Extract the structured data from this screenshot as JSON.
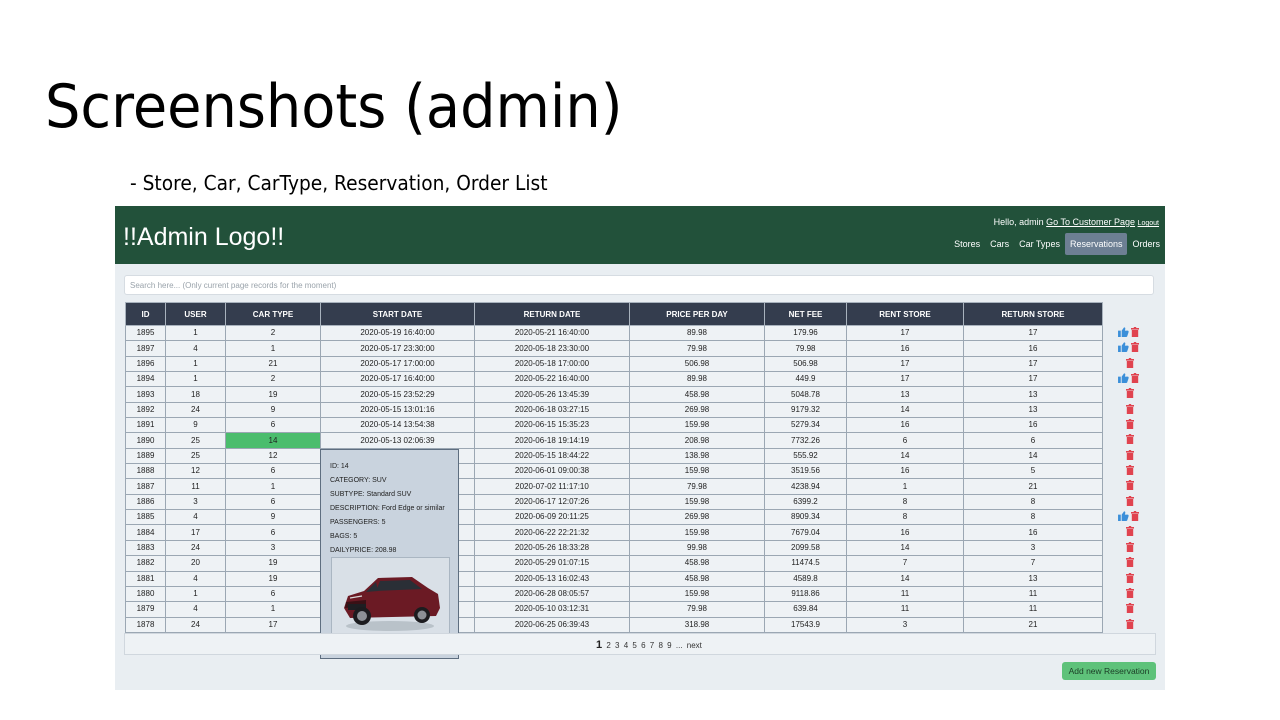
{
  "slide": {
    "title": "Screenshots (admin)",
    "subtitle": "- Store, Car, CarType, Reservation, Order List"
  },
  "app": {
    "logo": "!!Admin Logo!!",
    "greeting": "Hello, admin",
    "customer_link": "Go To Customer Page",
    "logout": "Logout",
    "nav": [
      "Stores",
      "Cars",
      "Car Types",
      "Reservations",
      "Orders"
    ],
    "active_nav": "Reservations",
    "colors": {
      "header": "#22513a",
      "table_header": "#343d4e",
      "highlight": "#4bbd6d",
      "add_button": "#5ec27a"
    }
  },
  "search": {
    "placeholder": "Search here... (Only current page records for the moment)",
    "value": ""
  },
  "table": {
    "columns": [
      "ID",
      "USER",
      "CAR TYPE",
      "START DATE",
      "RETURN DATE",
      "PRICE PER DAY",
      "NET FEE",
      "RENT STORE",
      "RETURN STORE"
    ],
    "rows": [
      [
        "1895",
        "1",
        "2",
        "2020-05-19 16:40:00",
        "2020-05-21 16:40:00",
        "89.98",
        "179.96",
        "17",
        "17"
      ],
      [
        "1897",
        "4",
        "1",
        "2020-05-17 23:30:00",
        "2020-05-18 23:30:00",
        "79.98",
        "79.98",
        "16",
        "16"
      ],
      [
        "1896",
        "1",
        "21",
        "2020-05-17 17:00:00",
        "2020-05-18 17:00:00",
        "506.98",
        "506.98",
        "17",
        "17"
      ],
      [
        "1894",
        "1",
        "2",
        "2020-05-17 16:40:00",
        "2020-05-22 16:40:00",
        "89.98",
        "449.9",
        "17",
        "17"
      ],
      [
        "1893",
        "18",
        "19",
        "2020-05-15 23:52:29",
        "2020-05-26 13:45:39",
        "458.98",
        "5048.78",
        "13",
        "13"
      ],
      [
        "1892",
        "24",
        "9",
        "2020-05-15 13:01:16",
        "2020-06-18 03:27:15",
        "269.98",
        "9179.32",
        "14",
        "13"
      ],
      [
        "1891",
        "9",
        "6",
        "2020-05-14 13:54:38",
        "2020-06-15 15:35:23",
        "159.98",
        "5279.34",
        "16",
        "16"
      ],
      [
        "1890",
        "25",
        "14",
        "2020-05-13 02:06:39",
        "2020-06-18 19:14:19",
        "208.98",
        "7732.26",
        "6",
        "6"
      ],
      [
        "1889",
        "25",
        "12",
        "",
        "2020-05-15 18:44:22",
        "138.98",
        "555.92",
        "14",
        "14"
      ],
      [
        "1888",
        "12",
        "6",
        "",
        "2020-06-01 09:00:38",
        "159.98",
        "3519.56",
        "16",
        "5"
      ],
      [
        "1887",
        "11",
        "1",
        "",
        "2020-07-02 11:17:10",
        "79.98",
        "4238.94",
        "1",
        "21"
      ],
      [
        "1886",
        "3",
        "6",
        "",
        "2020-06-17 12:07:26",
        "159.98",
        "6399.2",
        "8",
        "8"
      ],
      [
        "1885",
        "4",
        "9",
        "",
        "2020-06-09 20:11:25",
        "269.98",
        "8909.34",
        "8",
        "8"
      ],
      [
        "1884",
        "17",
        "6",
        "",
        "2020-06-22 22:21:32",
        "159.98",
        "7679.04",
        "16",
        "16"
      ],
      [
        "1883",
        "24",
        "3",
        "",
        "2020-05-26 18:33:28",
        "99.98",
        "2099.58",
        "14",
        "3"
      ],
      [
        "1882",
        "20",
        "19",
        "",
        "2020-05-29 01:07:15",
        "458.98",
        "11474.5",
        "7",
        "7"
      ],
      [
        "1881",
        "4",
        "19",
        "",
        "2020-05-13 16:02:43",
        "458.98",
        "4589.8",
        "14",
        "13"
      ],
      [
        "1880",
        "1",
        "6",
        "",
        "2020-06-28 08:05:57",
        "159.98",
        "9118.86",
        "11",
        "11"
      ],
      [
        "1879",
        "4",
        "1",
        "",
        "2020-05-10 03:12:31",
        "79.98",
        "639.84",
        "11",
        "11"
      ],
      [
        "1878",
        "24",
        "17",
        "",
        "2020-06-25 06:39:43",
        "318.98",
        "17543.9",
        "3",
        "21"
      ]
    ],
    "approve_rows": [
      0,
      1,
      3,
      12
    ],
    "highlighted_cell": {
      "row": 7,
      "column": "CAR TYPE"
    }
  },
  "popup": {
    "lines": [
      "ID: 14",
      "CATEGORY: SUV",
      "SUBTYPE: Standard SUV",
      "DESCRIPTION: Ford Edge or similar",
      "PASSENGERS: 5",
      "BAGS: 5",
      "DAILYPRICE: 208.98"
    ],
    "image": "car-image"
  },
  "pagination": {
    "current": "1",
    "pages": [
      "2",
      "3",
      "4",
      "5",
      "6",
      "7",
      "8",
      "9"
    ],
    "ellipsis": "...",
    "next": "next"
  },
  "add_button": "Add new Reservation"
}
